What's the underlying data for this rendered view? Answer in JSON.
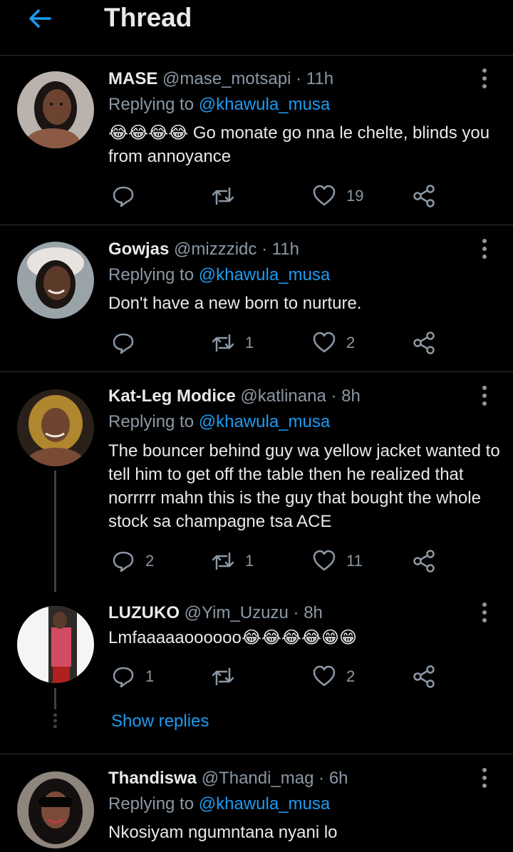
{
  "header": {
    "title": "Thread"
  },
  "tweets": [
    {
      "name": "MASE",
      "handle": "@mase_motsapi",
      "separator": "·",
      "time": "11h",
      "replying_label": "Replying to",
      "replying_to": "@khawula_musa",
      "text": "😂😂😂😂 Go monate go nna le chelte, blinds you from annoyance",
      "replies": "",
      "retweets": "",
      "likes": "19"
    },
    {
      "name": "Gowjas",
      "handle": "@mizzzidc",
      "separator": "·",
      "time": "11h",
      "replying_label": "Replying to",
      "replying_to": "@khawula_musa",
      "text": "Don't have a new born to nurture.",
      "replies": "",
      "retweets": "1",
      "likes": "2"
    },
    {
      "name": "Kat-Leg Modice",
      "handle": "@katlinana",
      "separator": "·",
      "time": "8h",
      "replying_label": "Replying to",
      "replying_to": "@khawula_musa",
      "text": "The bouncer behind guy wa yellow jacket wanted to tell him to get off the table then he realized that norrrrr mahn this is the guy that bought the whole stock sa champagne tsa ACE",
      "replies": "2",
      "retweets": "1",
      "likes": "11"
    },
    {
      "name": "LUZUKO",
      "handle": "@Yim_Uzuzu",
      "separator": "·",
      "time": "8h",
      "text": "Lmfaaaaaoooooo😂😂😂😂😁😁",
      "replies": "1",
      "retweets": "",
      "likes": "2"
    },
    {
      "name": "Thandiswa",
      "handle": "@Thandi_mag",
      "separator": "·",
      "time": "6h",
      "replying_label": "Replying to",
      "replying_to": "@khawula_musa",
      "text": "Nkosiyam ngumntana nyani lo"
    }
  ],
  "show_replies": "Show replies",
  "colors": {
    "background": "#000000",
    "accent": "#1d9bf0",
    "muted": "#8b98a5",
    "text": "#e7e9ea",
    "divider": "#2f3336"
  }
}
